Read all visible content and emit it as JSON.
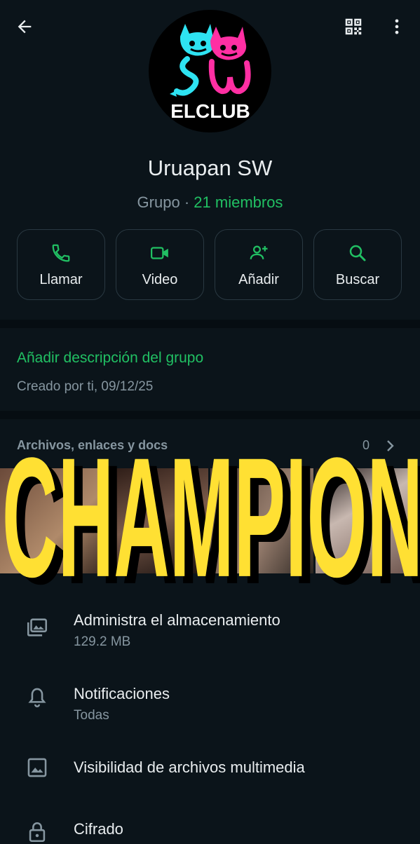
{
  "header": {
    "back_icon": "arrow-left-icon",
    "qr_icon": "qr-code-icon",
    "menu_icon": "more-vert-icon"
  },
  "avatar": {
    "logo_text": "ELCLUB"
  },
  "group": {
    "name": "Uruapan SW",
    "type_label": "Grupo",
    "separator": "·",
    "members": "21 miembros"
  },
  "actions": [
    {
      "label": "Llamar",
      "icon": "phone-icon"
    },
    {
      "label": "Video",
      "icon": "video-icon"
    },
    {
      "label": "Añadir",
      "icon": "add-person-icon"
    },
    {
      "label": "Buscar",
      "icon": "search-icon"
    }
  ],
  "info": {
    "add_description": "Añadir descripción del grupo",
    "created": "Creado por ti, 09/12/25"
  },
  "media": {
    "header": "Archivos, enlaces y docs",
    "count": "0",
    "overlay_text": "CHAMPION"
  },
  "settings": [
    {
      "title": "Administra el almacenamiento",
      "subtitle": "129.2 MB",
      "icon": "storage-icon"
    },
    {
      "title": "Notificaciones",
      "subtitle": "Todas",
      "icon": "bell-icon"
    },
    {
      "title": "Visibilidad de archivos multimedia",
      "icon": "image-icon"
    },
    {
      "title": "Cifrado",
      "icon": "lock-icon"
    }
  ],
  "colors": {
    "background": "#0b141a",
    "accent": "#21c063",
    "muted": "#8696a0",
    "champion": "#ffe033"
  }
}
